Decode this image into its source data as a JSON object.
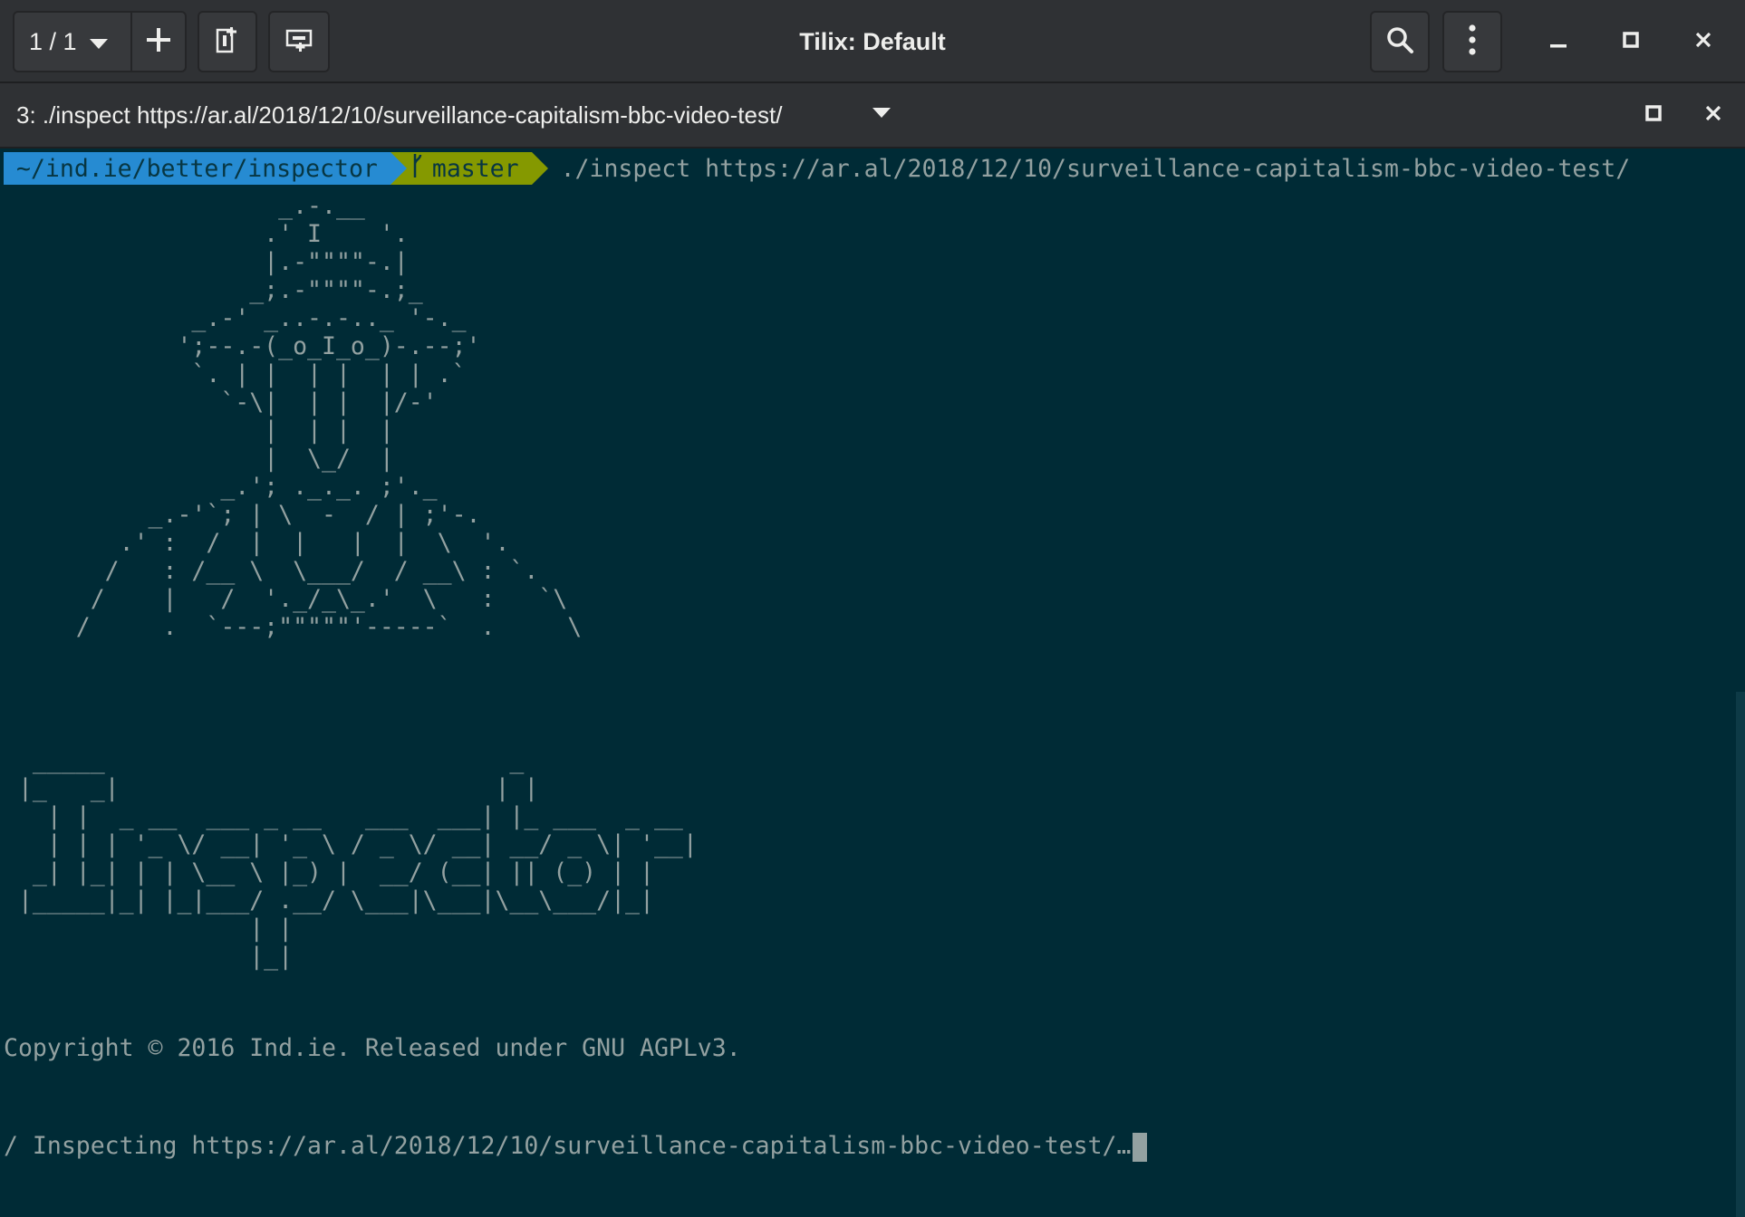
{
  "window": {
    "title": "Tilix: Default",
    "session_counter": "1 / 1",
    "icons": [
      "add-icon",
      "split-right-icon",
      "split-down-icon",
      "search-icon",
      "menu-icon",
      "minimize-icon",
      "maximize-icon",
      "close-icon"
    ]
  },
  "tab": {
    "title": "3: ./inspect https://ar.al/2018/12/10/surveillance-capitalism-bbc-video-test/"
  },
  "terminal": {
    "prompt_path": "~/ind.ie/better/inspector",
    "prompt_branch": "master",
    "command": "./inspect https://ar.al/2018/12/10/surveillance-capitalism-bbc-video-test/",
    "ascii_figure": "                   _.-.__\n                  .' I    '.\n                  |.-\"\"\"\"-.|\n                 _;.-\"\"\"\"-.;_\n             _.-' _..-.-.._ '-._\n            ';--.-(_o_I_o_)-.--;'\n             `. | |  | |  | | .`\n               `-\\|  | |  |/-'\n                  |  | |  |\n                  |  \\_/  |\n               _.'; ._._. ;'._\n          _.-'`; | \\  -  / | ;'-.\n        .' :  /  |  |   |  |  \\  '.\n       /   : /__ \\  \\___/  / __\\ : `.\n      /    |   /  '._/_\\_.'  \\   :   `\\\n     /     .  `---;\"\"\"\"\"'-----`  .     \\",
    "ascii_logo": "  _____                            _\n |_   _|                          | |\n   | |  _ __  ___ _ __   ___  ___| |_ ___  _ __\n   | | | '_ \\/ __| '_ \\ / _ \\/ __| __/ _ \\| '__|\n  _| |_| | | \\__ \\ |_) |  __/ (__| || (_) | |\n |_____|_| |_|___/ .__/ \\___|\\___|\\__\\___/|_|\n                 | |\n                 |_|",
    "copyright": "Copyright © 2016 Ind.ie. Released under GNU AGPLv3.",
    "status_line": "/ Inspecting https://ar.al/2018/12/10/surveillance-capitalism-bbc-video-test/…"
  },
  "colors": {
    "terminal_bg": "#002b36",
    "terminal_fg": "#93a1a1",
    "path_segment": "#268bd2",
    "git_segment": "#859900",
    "headerbar": "#2f3134"
  }
}
